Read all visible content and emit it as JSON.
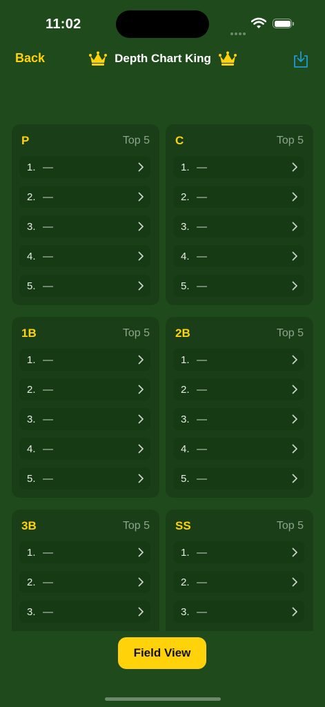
{
  "status": {
    "time": "11:02"
  },
  "nav": {
    "back_label": "Back",
    "title": "Depth Chart King"
  },
  "colors": {
    "accent": "#ffd20a",
    "background": "#1e4a1c",
    "card": "#1a3f18",
    "slot": "#163a14",
    "share_icon": "#1e9ad8"
  },
  "icons": {
    "crown": "crown-icon",
    "share": "share-icon",
    "chevron": "chevron-right-icon"
  },
  "positions": [
    {
      "code": "P",
      "subtitle": "Top 5",
      "slots": [
        {
          "rank": "1.",
          "player": "—"
        },
        {
          "rank": "2.",
          "player": "—"
        },
        {
          "rank": "3.",
          "player": "—"
        },
        {
          "rank": "4.",
          "player": "—"
        },
        {
          "rank": "5.",
          "player": "—"
        }
      ]
    },
    {
      "code": "C",
      "subtitle": "Top 5",
      "slots": [
        {
          "rank": "1.",
          "player": "—"
        },
        {
          "rank": "2.",
          "player": "—"
        },
        {
          "rank": "3.",
          "player": "—"
        },
        {
          "rank": "4.",
          "player": "—"
        },
        {
          "rank": "5.",
          "player": "—"
        }
      ]
    },
    {
      "code": "1B",
      "subtitle": "Top 5",
      "slots": [
        {
          "rank": "1.",
          "player": "—"
        },
        {
          "rank": "2.",
          "player": "—"
        },
        {
          "rank": "3.",
          "player": "—"
        },
        {
          "rank": "4.",
          "player": "—"
        },
        {
          "rank": "5.",
          "player": "—"
        }
      ]
    },
    {
      "code": "2B",
      "subtitle": "Top 5",
      "slots": [
        {
          "rank": "1.",
          "player": "—"
        },
        {
          "rank": "2.",
          "player": "—"
        },
        {
          "rank": "3.",
          "player": "—"
        },
        {
          "rank": "4.",
          "player": "—"
        },
        {
          "rank": "5.",
          "player": "—"
        }
      ]
    },
    {
      "code": "3B",
      "subtitle": "Top 5",
      "slots": [
        {
          "rank": "1.",
          "player": "—"
        },
        {
          "rank": "2.",
          "player": "—"
        },
        {
          "rank": "3.",
          "player": "—"
        }
      ]
    },
    {
      "code": "SS",
      "subtitle": "Top 5",
      "slots": [
        {
          "rank": "1.",
          "player": "—"
        },
        {
          "rank": "2.",
          "player": "—"
        },
        {
          "rank": "3.",
          "player": "—"
        }
      ]
    }
  ],
  "footer": {
    "field_view_label": "Field View"
  }
}
